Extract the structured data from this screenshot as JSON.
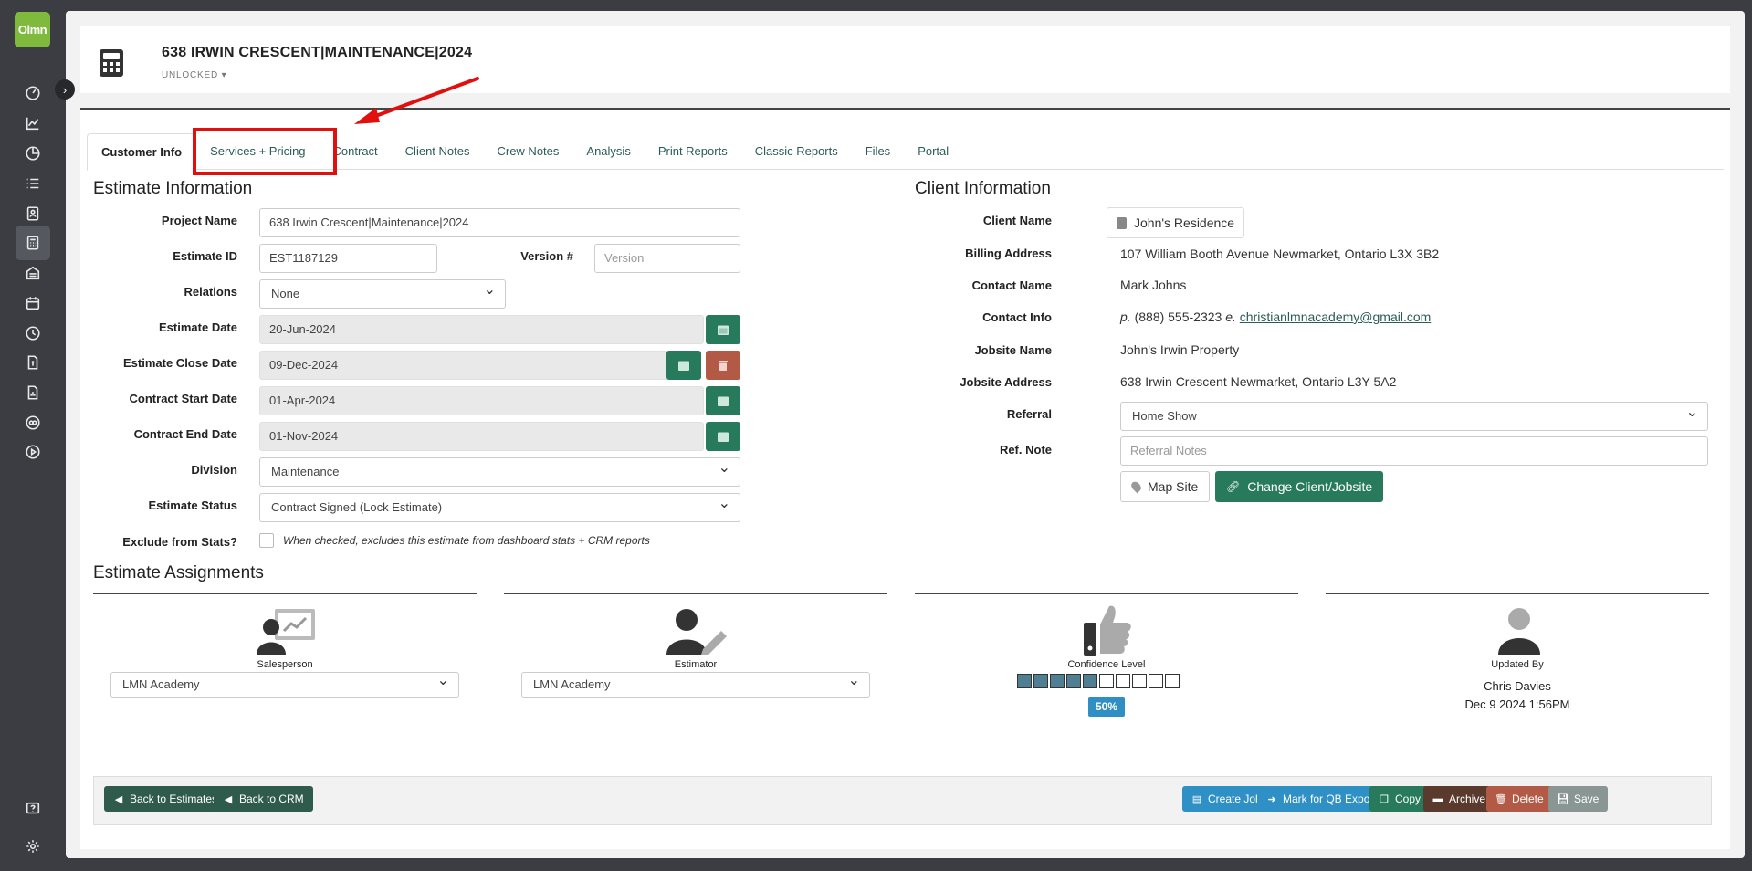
{
  "sidebar": {
    "logo_text": "Olmn",
    "items": [
      "dashboard-icon",
      "chart-icon",
      "pie-chart-icon",
      "list-icon",
      "contact-icon",
      "calculator-icon",
      "building-icon",
      "calendar-icon",
      "clock-icon",
      "invoice-icon",
      "report-icon",
      "qb-icon",
      "play-icon",
      "help-icon",
      "settings-icon"
    ]
  },
  "header": {
    "title": "638 IRWIN CRESCENT|MAINTENANCE|2024",
    "lock_status": "UNLOCKED"
  },
  "tabs": [
    {
      "label": "Customer Info",
      "active": true
    },
    {
      "label": "Services + Pricing",
      "active": false
    },
    {
      "label": "Contract",
      "active": false
    },
    {
      "label": "Client Notes",
      "active": false
    },
    {
      "label": "Crew Notes",
      "active": false
    },
    {
      "label": "Analysis",
      "active": false
    },
    {
      "label": "Print Reports",
      "active": false
    },
    {
      "label": "Classic Reports",
      "active": false
    },
    {
      "label": "Files",
      "active": false
    },
    {
      "label": "Portal",
      "active": false
    }
  ],
  "estimate": {
    "title": "Estimate Information",
    "project_name_label": "Project Name",
    "project_name": "638 Irwin Crescent|Maintenance|2024",
    "estimate_id_label": "Estimate ID",
    "estimate_id": "EST1187129",
    "version_label": "Version #",
    "version_placeholder": "Version",
    "relations_label": "Relations",
    "relations": "None",
    "estimate_date_label": "Estimate Date",
    "estimate_date": "20-Jun-2024",
    "close_date_label": "Estimate Close Date",
    "close_date": "09-Dec-2024",
    "start_date_label": "Contract Start Date",
    "start_date": "01-Apr-2024",
    "end_date_label": "Contract End Date",
    "end_date": "01-Nov-2024",
    "division_label": "Division",
    "division": "Maintenance",
    "status_label": "Estimate Status",
    "status": "Contract Signed (Lock Estimate)",
    "exclude_label": "Exclude from Stats?",
    "exclude_note": "When checked, excludes this estimate from dashboard stats + CRM reports"
  },
  "client": {
    "title": "Client Information",
    "client_name_label": "Client Name",
    "client_name": "John's Residence",
    "billing_label": "Billing Address",
    "billing": "107 William Booth Avenue Newmarket, Ontario L3X 3B2",
    "contact_name_label": "Contact Name",
    "contact_name": "Mark Johns",
    "contact_info_label": "Contact Info",
    "phone_prefix": "p.",
    "phone": "(888) 555-2323",
    "email_prefix": "e.",
    "email": "christianlmnacademy@gmail.com",
    "jobsite_name_label": "Jobsite Name",
    "jobsite_name": "John's Irwin Property",
    "jobsite_address_label": "Jobsite Address",
    "jobsite_address": "638 Irwin Crescent Newmarket, Ontario L3Y 5A2",
    "referral_label": "Referral",
    "referral": "Home Show",
    "ref_note_label": "Ref. Note",
    "ref_note_placeholder": "Referral Notes",
    "map_site": "Map Site",
    "change_client": "Change Client/Jobsite"
  },
  "assignments": {
    "title": "Estimate Assignments",
    "salesperson_label": "Salesperson",
    "salesperson": "LMN Academy",
    "estimator_label": "Estimator",
    "estimator": "LMN Academy",
    "confidence_label": "Confidence Level",
    "confidence_value": 0.5,
    "confidence_text": "50%",
    "updated_label": "Updated By",
    "updated_by": "Chris Davies",
    "updated_at": "Dec 9 2024 1:56PM"
  },
  "footer": {
    "back_estimates": "Back to Estimates",
    "back_crm": "Back to CRM",
    "create_job": "Create Job",
    "mark_qb": "Mark for QB Export",
    "copy": "Copy",
    "archive": "Archive",
    "delete": "Delete",
    "save": "Save"
  },
  "colors": {
    "accent_green": "#287a5c",
    "danger": "#b25a45",
    "info_blue": "#2f90c5",
    "highlight_red": "#e20f0f"
  }
}
